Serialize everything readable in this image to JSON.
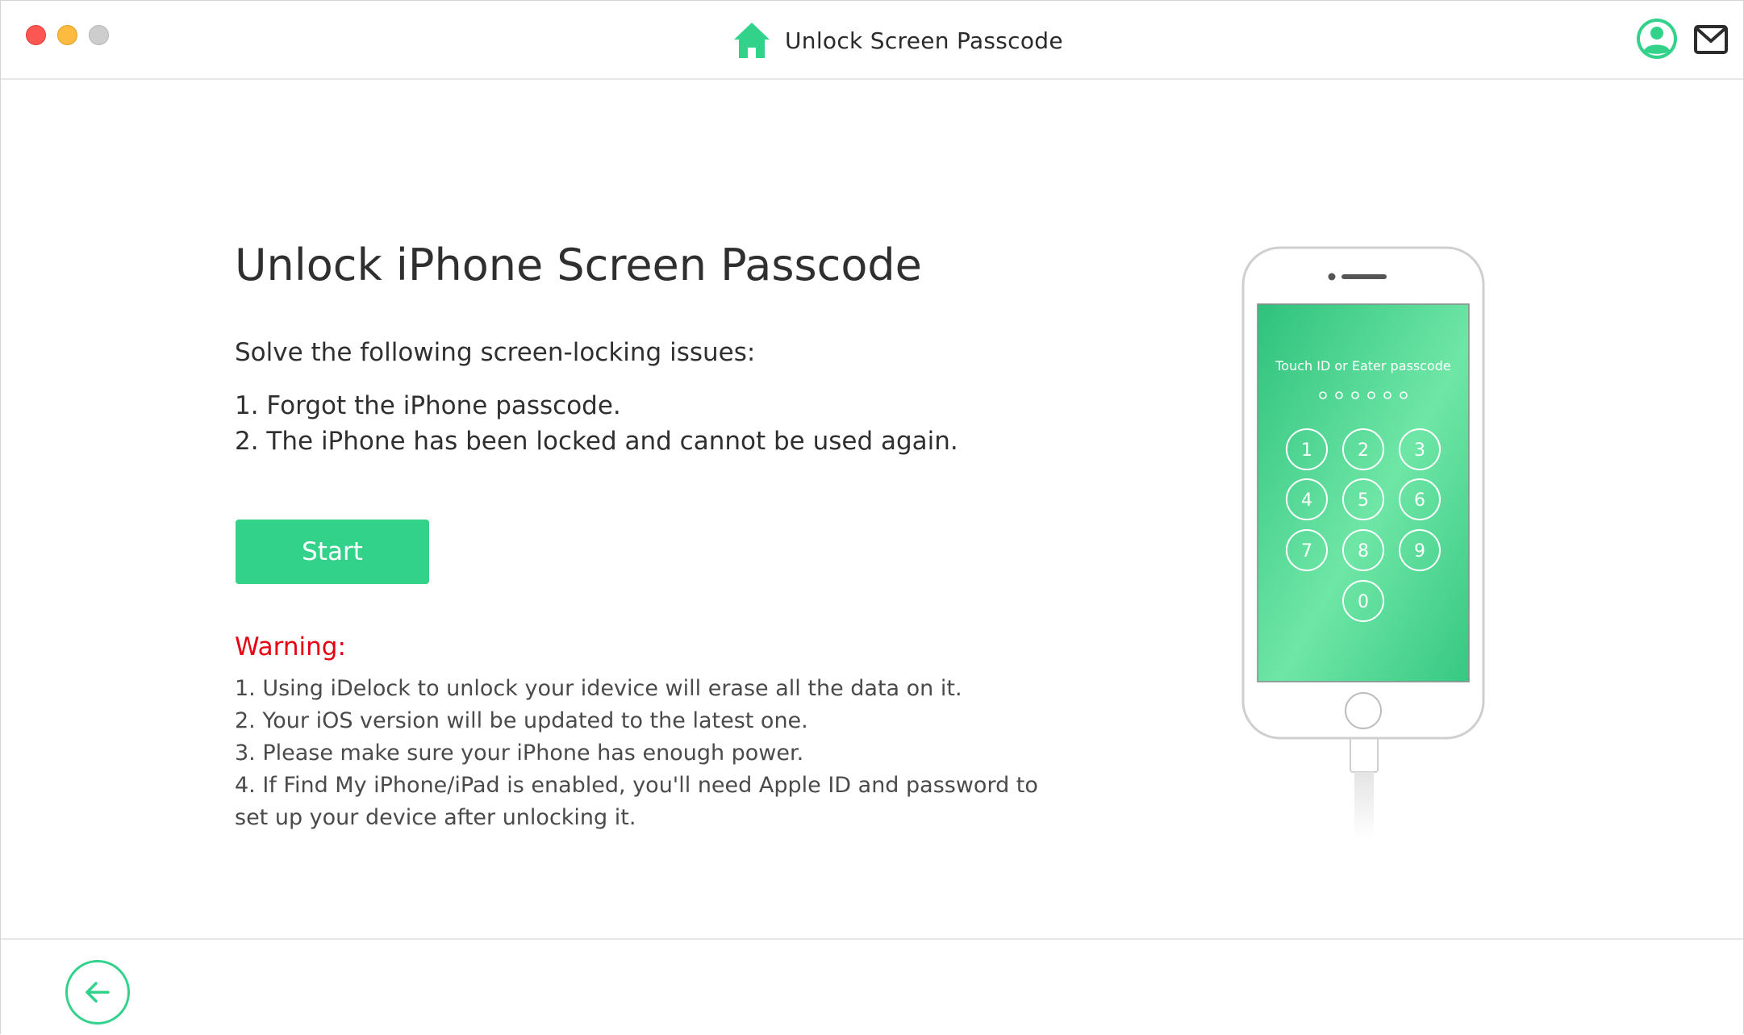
{
  "window": {
    "title": "Unlock Screen Passcode"
  },
  "header": {
    "icons": {
      "home": "home-icon",
      "account": "account-icon",
      "mail": "mail-icon"
    }
  },
  "main": {
    "title": "Unlock iPhone Screen Passcode",
    "issues_intro": "Solve the following screen-locking issues:",
    "issues": [
      "1. Forgot the iPhone passcode.",
      "2. The iPhone has been locked and cannot be used again."
    ],
    "start_label": "Start",
    "warning_title": "Warning:",
    "warnings": [
      "1. Using iDelock to unlock your idevice will erase all the data on it.",
      "2. Your iOS version will be updated to the latest one.",
      "3. Please make sure your iPhone has enough power.",
      "4. If Find My iPhone/iPad is enabled, you'll need Apple ID and password to set up your device after unlocking it."
    ]
  },
  "phone": {
    "prompt": "Touch ID or Eater passcode",
    "keys": [
      "1",
      "2",
      "3",
      "4",
      "5",
      "6",
      "7",
      "8",
      "9",
      "0"
    ]
  },
  "footer": {
    "back_icon": "back-arrow-icon"
  },
  "colors": {
    "accent": "#33d28a",
    "warning": "#e60012",
    "text": "#2f2f2f",
    "close": "#fc5753",
    "minimize": "#fdbc40",
    "zoom": "#cdcdcd"
  }
}
